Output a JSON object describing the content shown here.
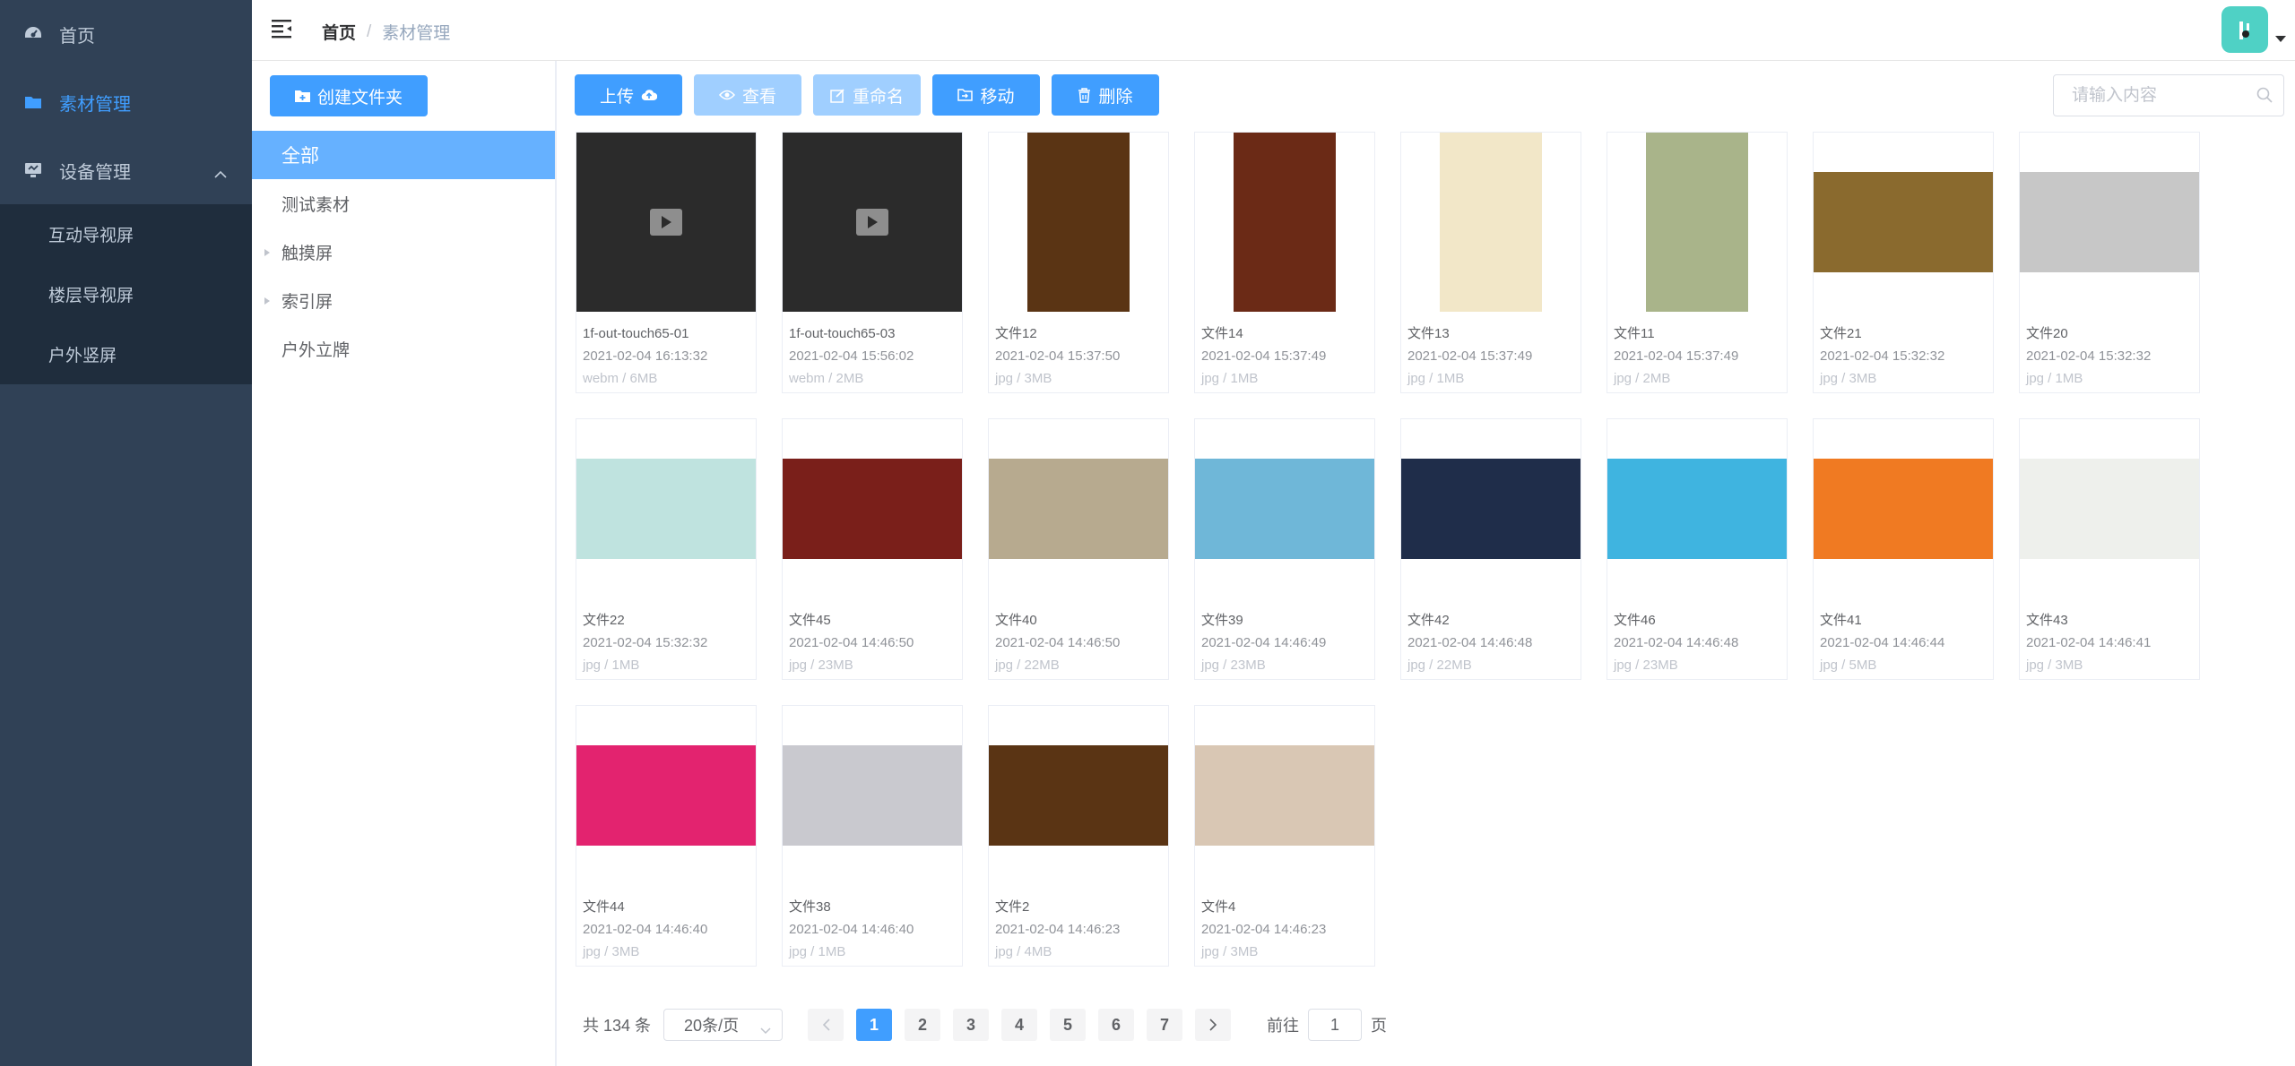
{
  "sidebar": {
    "items": [
      {
        "label": "首页",
        "icon": "dashboard-icon"
      },
      {
        "label": "素材管理",
        "icon": "folder-icon",
        "active": true
      },
      {
        "label": "设备管理",
        "icon": "device-icon",
        "expanded": true
      }
    ],
    "subitems": [
      {
        "label": "互动导视屏"
      },
      {
        "label": "楼层导视屏"
      },
      {
        "label": "户外竖屏"
      }
    ]
  },
  "header": {
    "breadcrumb_home": "首页",
    "breadcrumb_sep": "/",
    "breadcrumb_current": "素材管理"
  },
  "folders": {
    "create_label": "创建文件夹",
    "tree": [
      {
        "label": "全部",
        "active": true,
        "expandable": false
      },
      {
        "label": "测试素材",
        "expandable": false
      },
      {
        "label": "触摸屏",
        "expandable": true
      },
      {
        "label": "索引屏",
        "expandable": true
      },
      {
        "label": "户外立牌",
        "expandable": false
      }
    ]
  },
  "toolbar": {
    "upload_label": "上传",
    "view_label": "查看",
    "rename_label": "重命名",
    "move_label": "移动",
    "delete_label": "删除"
  },
  "search": {
    "placeholder": "请输入内容"
  },
  "files": [
    {
      "name": "1f-out-touch65-01",
      "time": "2021-02-04 16:13:32",
      "size": "webm / 6MB",
      "type": "video",
      "color": "#2b2b2b",
      "shape": "video"
    },
    {
      "name": "1f-out-touch65-03",
      "time": "2021-02-04 15:56:02",
      "size": "webm / 2MB",
      "type": "video",
      "color": "#2b2b2b",
      "shape": "video"
    },
    {
      "name": "文件12",
      "time": "2021-02-04 15:37:50",
      "size": "jpg / 3MB",
      "type": "image",
      "color": "#5a3414",
      "shape": "portrait"
    },
    {
      "name": "文件14",
      "time": "2021-02-04 15:37:49",
      "size": "jpg / 1MB",
      "type": "image",
      "color": "#6b2a16",
      "shape": "portrait"
    },
    {
      "name": "文件13",
      "time": "2021-02-04 15:37:49",
      "size": "jpg / 1MB",
      "type": "image",
      "color": "#f2e7c8",
      "shape": "portrait"
    },
    {
      "name": "文件11",
      "time": "2021-02-04 15:37:49",
      "size": "jpg / 2MB",
      "type": "image",
      "color": "#a9b48a",
      "shape": "portrait"
    },
    {
      "name": "文件21",
      "time": "2021-02-04 15:32:32",
      "size": "jpg / 3MB",
      "type": "image",
      "color": "#8a6a2e",
      "shape": "landscape"
    },
    {
      "name": "文件20",
      "time": "2021-02-04 15:32:32",
      "size": "jpg / 1MB",
      "type": "image",
      "color": "#c7c7c7",
      "shape": "landscape"
    },
    {
      "name": "文件22",
      "time": "2021-02-04 15:32:32",
      "size": "jpg / 1MB",
      "type": "image",
      "color": "#bfe3df",
      "shape": "landscape"
    },
    {
      "name": "文件45",
      "time": "2021-02-04 14:46:50",
      "size": "jpg / 23MB",
      "type": "image",
      "color": "#7a1f1a",
      "shape": "landscape"
    },
    {
      "name": "文件40",
      "time": "2021-02-04 14:46:50",
      "size": "jpg / 22MB",
      "type": "image",
      "color": "#b7aa8f",
      "shape": "landscape"
    },
    {
      "name": "文件39",
      "time": "2021-02-04 14:46:49",
      "size": "jpg / 23MB",
      "type": "image",
      "color": "#6fb7d8",
      "shape": "landscape"
    },
    {
      "name": "文件42",
      "time": "2021-02-04 14:46:48",
      "size": "jpg / 22MB",
      "type": "image",
      "color": "#1f2d4a",
      "shape": "landscape"
    },
    {
      "name": "文件46",
      "time": "2021-02-04 14:46:48",
      "size": "jpg / 23MB",
      "type": "image",
      "color": "#3fb4e0",
      "shape": "landscape"
    },
    {
      "name": "文件41",
      "time": "2021-02-04 14:46:44",
      "size": "jpg / 5MB",
      "type": "image",
      "color": "#f07a22",
      "shape": "landscape"
    },
    {
      "name": "文件43",
      "time": "2021-02-04 14:46:41",
      "size": "jpg / 3MB",
      "type": "image",
      "color": "#eef0ec",
      "shape": "landscape"
    },
    {
      "name": "文件44",
      "time": "2021-02-04 14:46:40",
      "size": "jpg / 3MB",
      "type": "image",
      "color": "#e3236f",
      "shape": "landscape"
    },
    {
      "name": "文件38",
      "time": "2021-02-04 14:46:40",
      "size": "jpg / 1MB",
      "type": "image",
      "color": "#c9c9cf",
      "shape": "landscape"
    },
    {
      "name": "文件2",
      "time": "2021-02-04 14:46:23",
      "size": "jpg / 4MB",
      "type": "image",
      "color": "#5a3414",
      "shape": "landscape"
    },
    {
      "name": "文件4",
      "time": "2021-02-04 14:46:23",
      "size": "jpg / 3MB",
      "type": "image",
      "color": "#d9c7b4",
      "shape": "landscape"
    }
  ],
  "pagination": {
    "total_label": "共 134 条",
    "page_size_label": "20条/页",
    "pages": [
      "1",
      "2",
      "3",
      "4",
      "5",
      "6",
      "7"
    ],
    "current_page": 1,
    "goto_label": "前往",
    "goto_value": "1",
    "page_unit": "页"
  },
  "colors": {
    "primary": "#409eff",
    "primary_disabled": "#a0cfff",
    "sidebar_bg": "#304156",
    "sidebar_submenu_bg": "#1f2d3d",
    "avatar_bg": "#4fd1c5"
  }
}
